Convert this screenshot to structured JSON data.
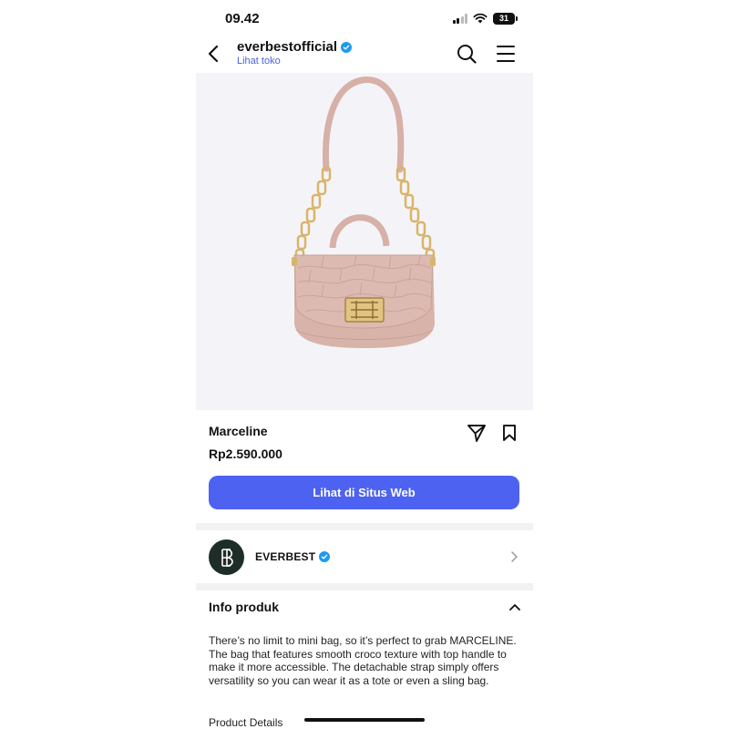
{
  "status_bar": {
    "time": "09.42",
    "battery": "31",
    "icons": [
      "signal-icon",
      "wifi-icon",
      "battery-icon"
    ]
  },
  "header": {
    "store_name": "everbestofficial",
    "store_link": "Lihat toko",
    "icons": [
      "back-arrow-icon",
      "verified-badge-icon",
      "search-icon",
      "menu-icon"
    ]
  },
  "product": {
    "title": "Marceline",
    "price": "Rp2.590.000",
    "website_button": "Lihat di Situs Web",
    "icons": [
      "share-icon",
      "bookmark-icon"
    ]
  },
  "brand": {
    "name": "EVERBEST",
    "icons": [
      "brand-logo",
      "verified-badge-icon",
      "chevron-right-icon"
    ]
  },
  "info": {
    "heading": "Info produk",
    "description": "There’s no limit to mini bag, so it’s perfect to grab MARCELINE. The bag that features smooth croco texture with top handle to make it more accessible. The detachable strap simply offers versatility so you can wear it as a tote or even a sling bag.",
    "details_label": "Product Details",
    "icons": [
      "chevron-up-icon"
    ]
  },
  "colors": {
    "accent": "#4d62f1",
    "link": "#4a63e0",
    "verified": "#1d9bf0",
    "brand_logo_bg": "#1f2d28",
    "bag": "#d9b5ad"
  }
}
